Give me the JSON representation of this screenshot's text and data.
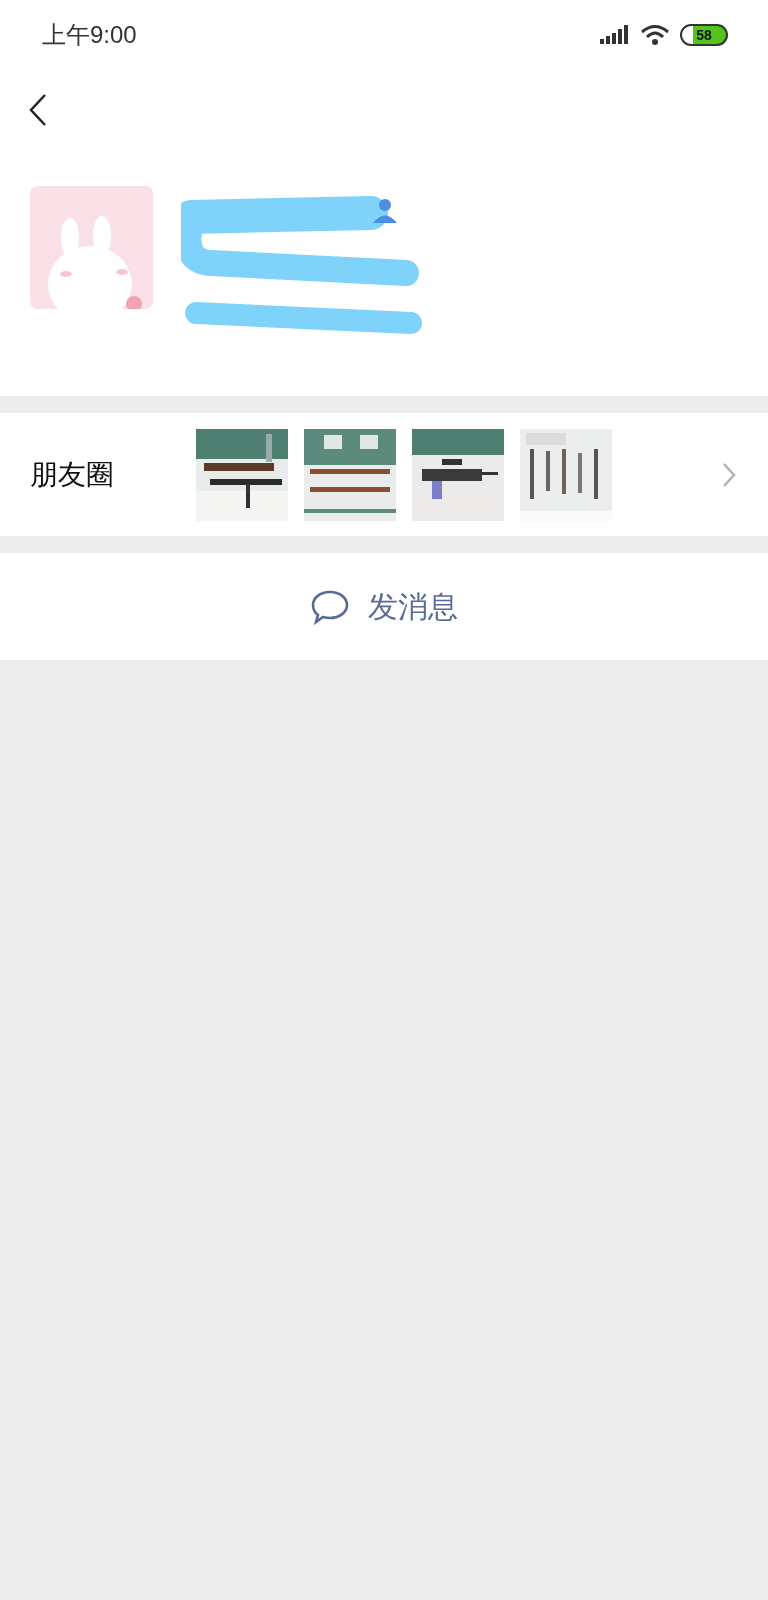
{
  "status_bar": {
    "time": "上午9:00",
    "battery": "58"
  },
  "profile": {
    "redacted": true
  },
  "moments": {
    "label": "朋友圈"
  },
  "send_message": {
    "label": "发消息"
  }
}
